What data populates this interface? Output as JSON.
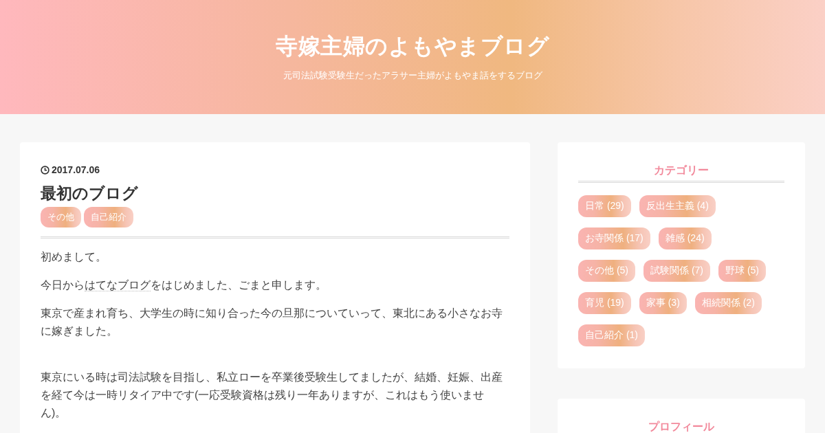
{
  "header": {
    "title": "寺嫁主婦のよもやまブログ",
    "subtitle": "元司法試験受験生だったアラサー主婦がよもやま話をするブログ"
  },
  "article": {
    "date": "2017.07.06",
    "title": "最初のブログ",
    "tags": [
      "その他",
      "自己紹介"
    ],
    "sections": [
      {
        "paragraphs": [
          {
            "segments": [
              {
                "text": "初めまして。",
                "link": false
              }
            ]
          },
          {
            "segments": [
              {
                "text": "今日から",
                "link": false
              },
              {
                "text": "はてなブログ",
                "link": true
              },
              {
                "text": "をはじめました、ごまと申します。",
                "link": false
              }
            ]
          },
          {
            "segments": [
              {
                "text": "東京で産まれ育ち、大学生の時に知り合った今の旦那についていって、東北にある小さなお寺に嫁ぎました。",
                "link": false
              }
            ]
          }
        ]
      },
      {
        "paragraphs": [
          {
            "segments": [
              {
                "text": "東京にいる時は司法試験を目指し、私立ローを卒業後受験生してましたが、結婚、妊娠、出産を経て今は一時リタイア中です(一応受験資格は残り一年ありますが、これはもう使いません)。",
                "link": false
              }
            ]
          }
        ]
      }
    ]
  },
  "sidebar": {
    "widgets": [
      {
        "title": "カテゴリー",
        "categories": [
          "日常 (29)",
          "反出生主義 (4)",
          "お寺関係 (17)",
          "雑感 (24)",
          "その他 (5)",
          "試験関係 (7)",
          "野球 (5)",
          "育児 (19)",
          "家事 (3)",
          "相続関係 (2)",
          "自己紹介 (1)"
        ]
      },
      {
        "title": "プロフィール"
      }
    ]
  }
}
